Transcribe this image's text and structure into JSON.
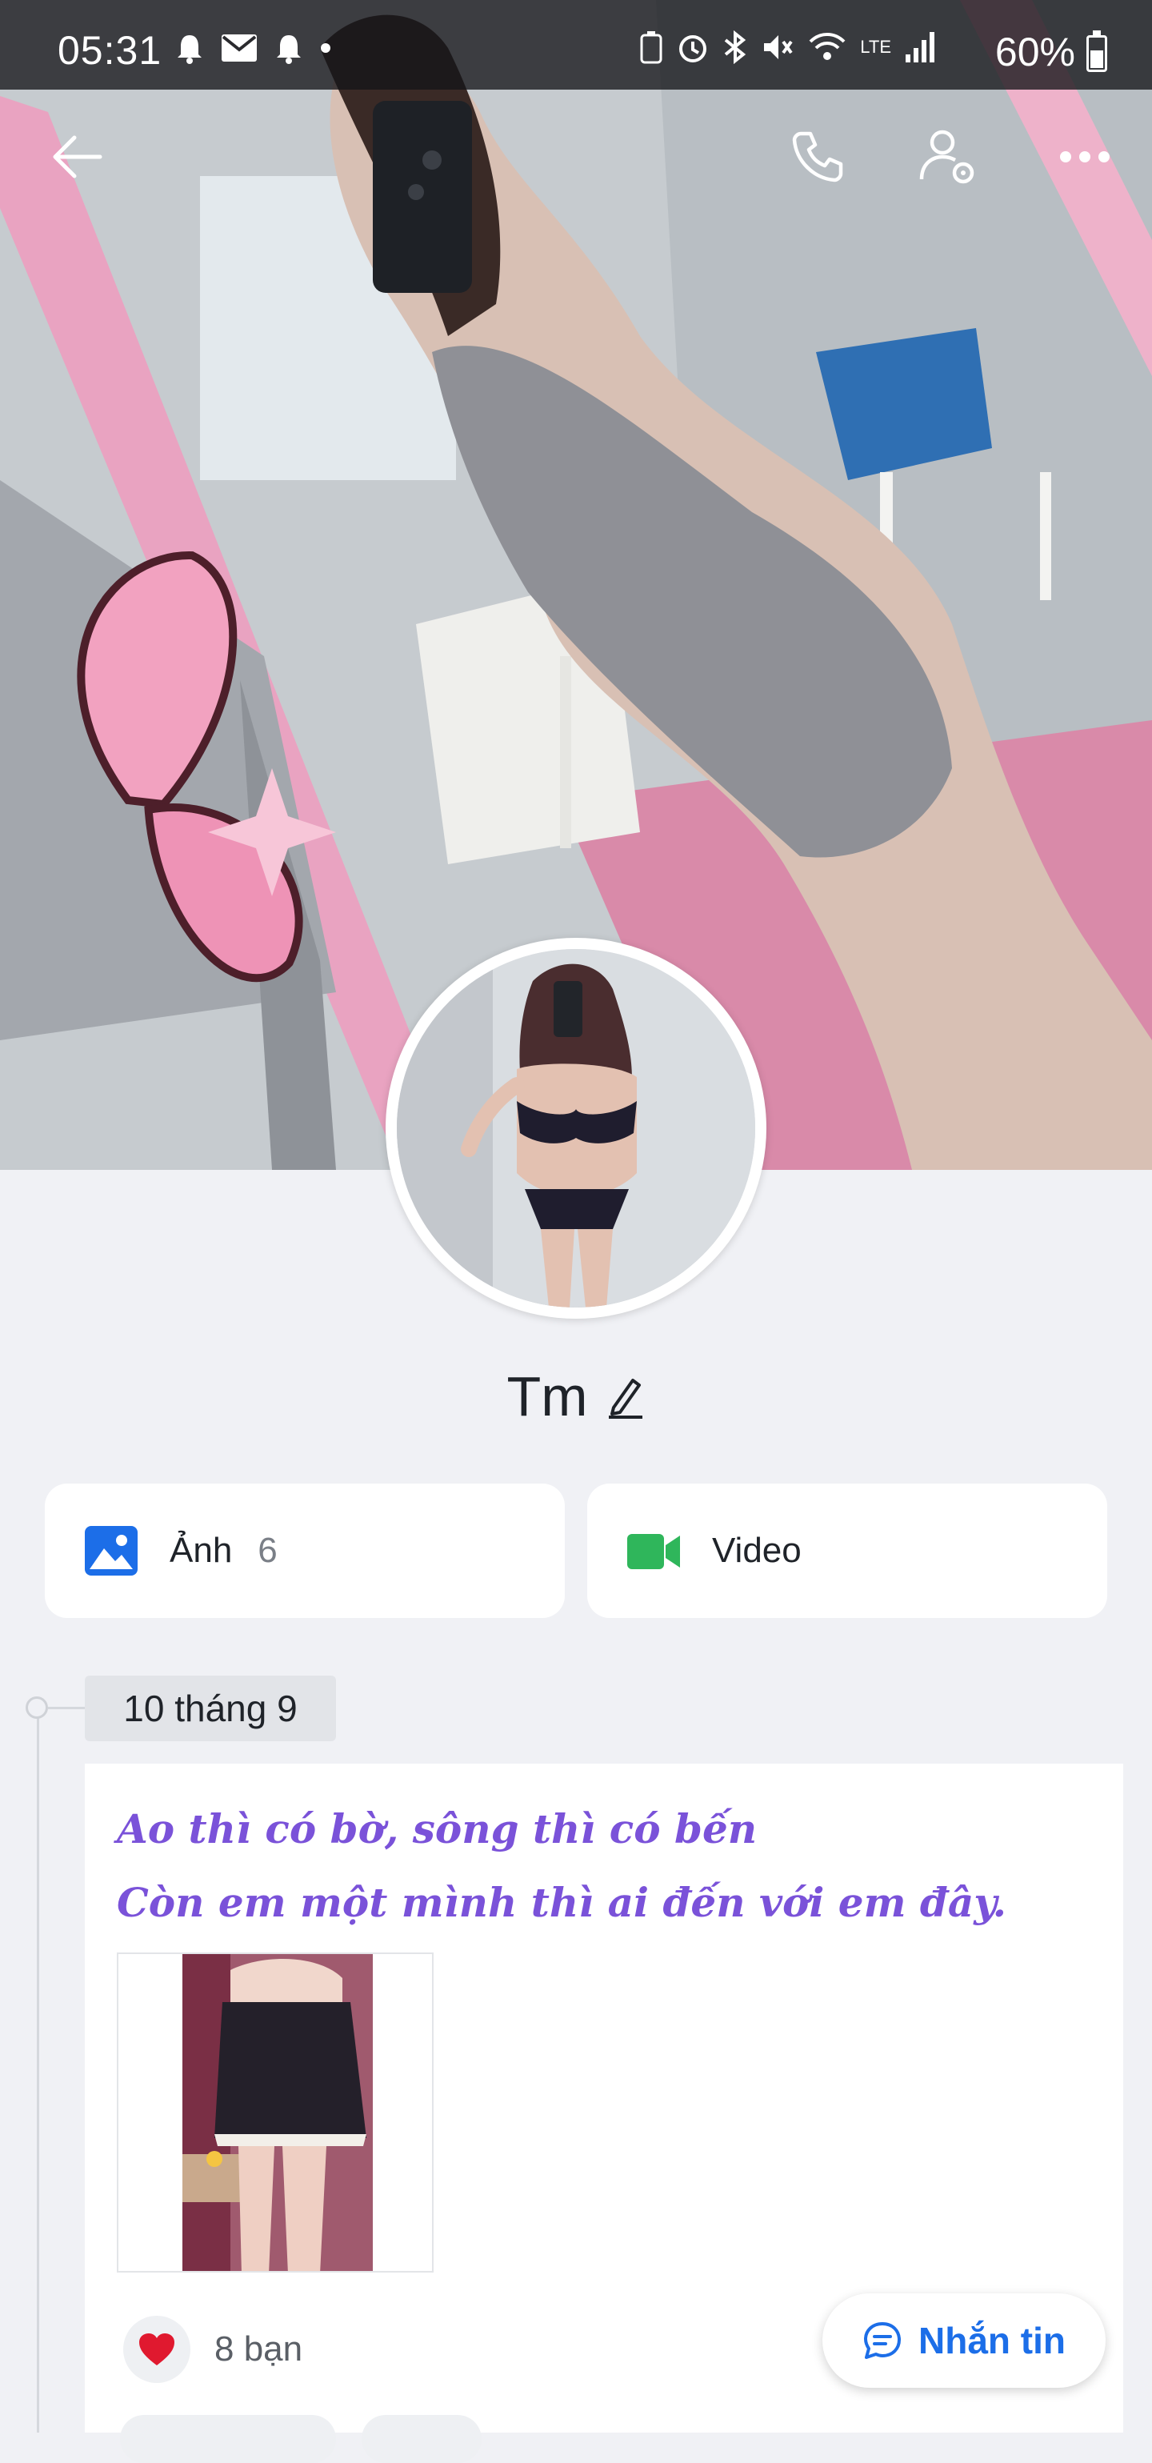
{
  "status_bar": {
    "time": "05:31",
    "battery": "60%",
    "network_label": "LTE"
  },
  "top_bar": {
    "back_icon": "arrow-left-icon",
    "call_icon": "phone-icon",
    "settings_icon": "user-settings-icon",
    "more_icon": "more-horizontal-icon"
  },
  "profile": {
    "name": "Tm",
    "edit_icon": "pencil-icon"
  },
  "media": {
    "photos_label": "Ảnh",
    "photos_count": "6",
    "video_label": "Video",
    "photos_icon_color": "#1c6ee8",
    "video_icon_color": "#2fb65b"
  },
  "timeline": {
    "date": "10 tháng 9"
  },
  "post": {
    "line1": "Ao thì có bờ, sông thì có bến",
    "line2": "Còn em một mình thì ai đến với em đây.",
    "text_color": "#7a52d9",
    "reaction_icon": "heart-icon",
    "reaction_text": "8 bạn"
  },
  "chat_button": {
    "label": "Nhắn tin",
    "icon": "chat-bubble-icon"
  }
}
